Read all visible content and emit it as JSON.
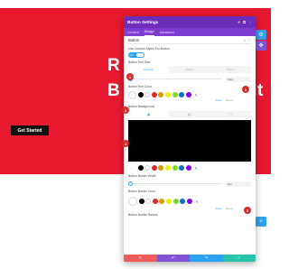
{
  "hero": {
    "headline_line1": "R",
    "headline_line2": "B",
    "headline_line2_tail": "sit",
    "cta_label": "Get Started",
    "bg_color": "#e8192e"
  },
  "modal": {
    "title": "Button Settings",
    "tabs": [
      "Content",
      "Design",
      "Advanced"
    ],
    "active_tab": "Design",
    "section_title": "Button",
    "custom_styles_label": "Use Custom Styles For Button",
    "custom_styles_value": "Yes",
    "text_size_label": "Button Text Size",
    "device_tabs": [
      "Desktop",
      "Tablet",
      "Phone"
    ],
    "text_size_value": "18px",
    "text_color_label": "Button Text Color",
    "saved_label": "Saved",
    "recent_label": "Recent",
    "background_label": "Button Background",
    "border_width_label": "Button Border Width",
    "border_width_value": "0px",
    "border_color_label": "Button Border Color",
    "border_radius_label": "Button Border Radius"
  },
  "badges": [
    "1",
    "2",
    "3",
    "4",
    "5"
  ],
  "palette": [
    "#000000",
    "#ffffff",
    "#e02b20",
    "#e09900",
    "#edf000",
    "#7cda24",
    "#0c71c3",
    "#8300e9"
  ],
  "colors": {
    "accent": "#2ea3f2",
    "header": "#6c2eb9",
    "footer_cancel": "#ef5b5b",
    "footer_undo": "#8155d6",
    "footer_redo": "#2ea3f2",
    "footer_save": "#29c4a9"
  }
}
